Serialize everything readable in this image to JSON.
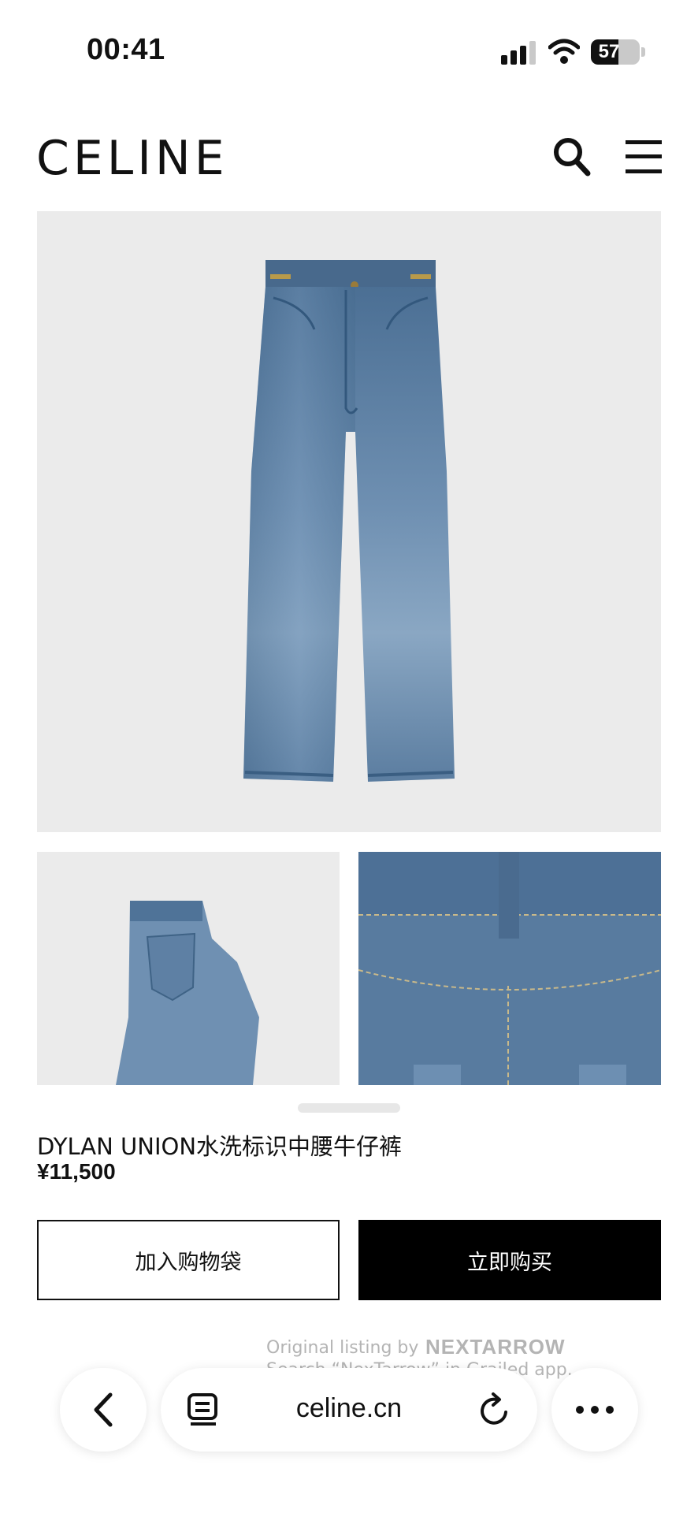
{
  "status_bar": {
    "time": "00:41",
    "battery": "57",
    "battery_level": 0.57
  },
  "header": {
    "logo": "CELINE",
    "icons": [
      "search-icon",
      "menu-icon"
    ]
  },
  "images": [
    "jeans-front",
    "jeans-back-folded",
    "jeans-back-detail"
  ],
  "product": {
    "name": "DYLAN UNION水洗标识中腰牛仔裤",
    "price": "¥11,500",
    "add_to_bag_label": "加入购物袋",
    "buy_now_label": "立即购买"
  },
  "watermark": {
    "line1": "Original listing by",
    "brand": "NEXTARROW",
    "line2": "Search “NexTarrow” in Grailed app."
  },
  "browser": {
    "url": "celine.cn",
    "icons": [
      "back-icon",
      "tabs-icon",
      "reload-icon",
      "more-icon"
    ]
  },
  "colors": {
    "denim": "#5b7fa6",
    "button_dark": "#000000",
    "image_bg": "#ebebeb"
  }
}
